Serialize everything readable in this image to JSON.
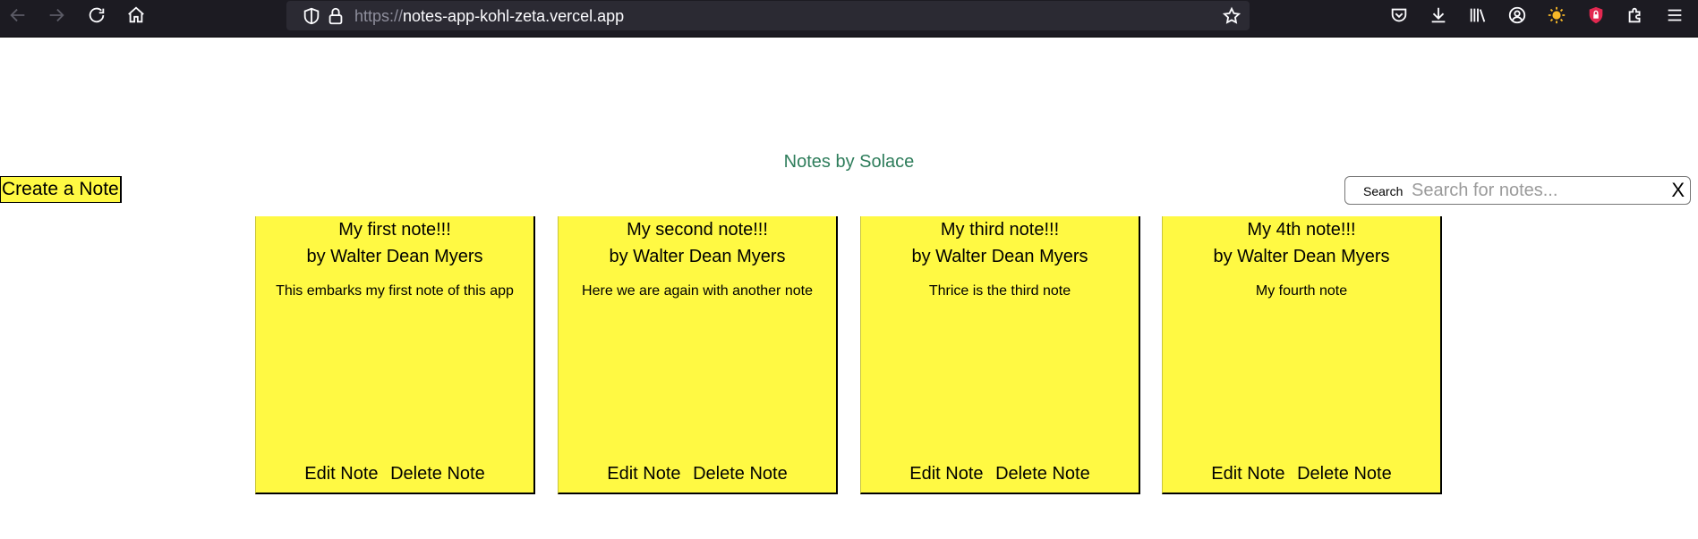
{
  "browser": {
    "url_scheme": "https://",
    "url_host": "notes-app-kohl-zeta.vercel.app"
  },
  "page": {
    "title": "Notes by Solace",
    "create_button": "Create a Note",
    "search": {
      "label": "Search",
      "placeholder": "Search for notes...",
      "value": "",
      "clear": "X"
    }
  },
  "notes": [
    {
      "title": "My first note!!!",
      "author": "by Walter Dean Myers",
      "body": "This embarks my first note of this app",
      "edit": "Edit Note",
      "delete": "Delete Note"
    },
    {
      "title": "My second note!!!",
      "author": "by Walter Dean Myers",
      "body": "Here we are again with another note",
      "edit": "Edit Note",
      "delete": "Delete Note"
    },
    {
      "title": "My third note!!!",
      "author": "by Walter Dean Myers",
      "body": "Thrice is the third note",
      "edit": "Edit Note",
      "delete": "Delete Note"
    },
    {
      "title": "My 4th note!!!",
      "author": "by Walter Dean Myers",
      "body": "My fourth note",
      "edit": "Edit Note",
      "delete": "Delete Note"
    }
  ],
  "colors": {
    "note_background": "#fff943",
    "title_color": "#2e7d5b",
    "toolbar_background": "#1c1b22",
    "urlbar_background": "#2b2a33"
  }
}
